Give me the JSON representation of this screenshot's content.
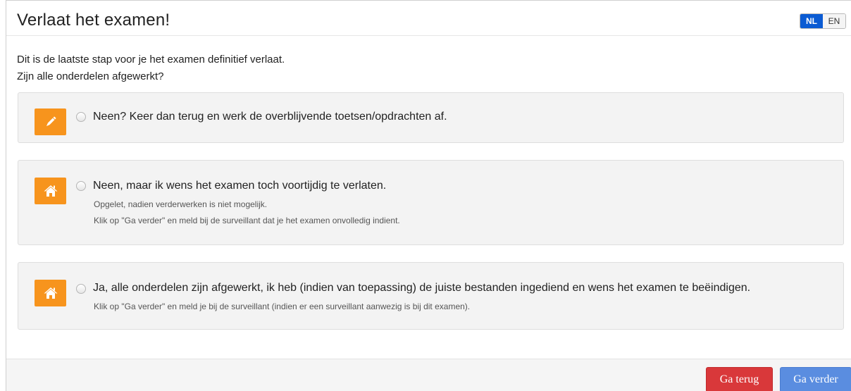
{
  "header": {
    "title": "Verlaat het examen!",
    "language": {
      "options": [
        "NL",
        "EN"
      ],
      "selected": "NL"
    }
  },
  "intro": {
    "line1": "Dit is de laatste stap voor je het examen definitief verlaat.",
    "line2": "Zijn alle onderdelen afgewerkt?"
  },
  "options": [
    {
      "icon": "pencil-icon",
      "label": "Neen? Keer dan terug en werk de overblijvende toetsen/opdrachten af.",
      "selected": false,
      "notes": []
    },
    {
      "icon": "home-icon",
      "label": "Neen, maar ik wens het examen toch voortijdig te verlaten.",
      "selected": false,
      "notes": [
        "Opgelet, nadien verderwerken is niet mogelijk.",
        "Klik op \"Ga verder\" en meld bij de surveillant dat je het examen onvolledig indient."
      ]
    },
    {
      "icon": "home-icon",
      "label": "Ja, alle onderdelen zijn afgewerkt, ik heb (indien van toepassing) de juiste bestanden ingediend en wens het examen te beëindigen.",
      "selected": false,
      "notes": [
        "Klik op \"Ga verder\" en meld je bij de surveillant (indien er een surveillant aanwezig is bij dit examen)."
      ]
    }
  ],
  "footer": {
    "back_label": "Ga terug",
    "next_label": "Ga verder"
  },
  "colors": {
    "accent_orange": "#f7941d",
    "lang_active": "#0b5bd3",
    "back_button": "#d9383a",
    "next_button": "#5a8de0"
  }
}
